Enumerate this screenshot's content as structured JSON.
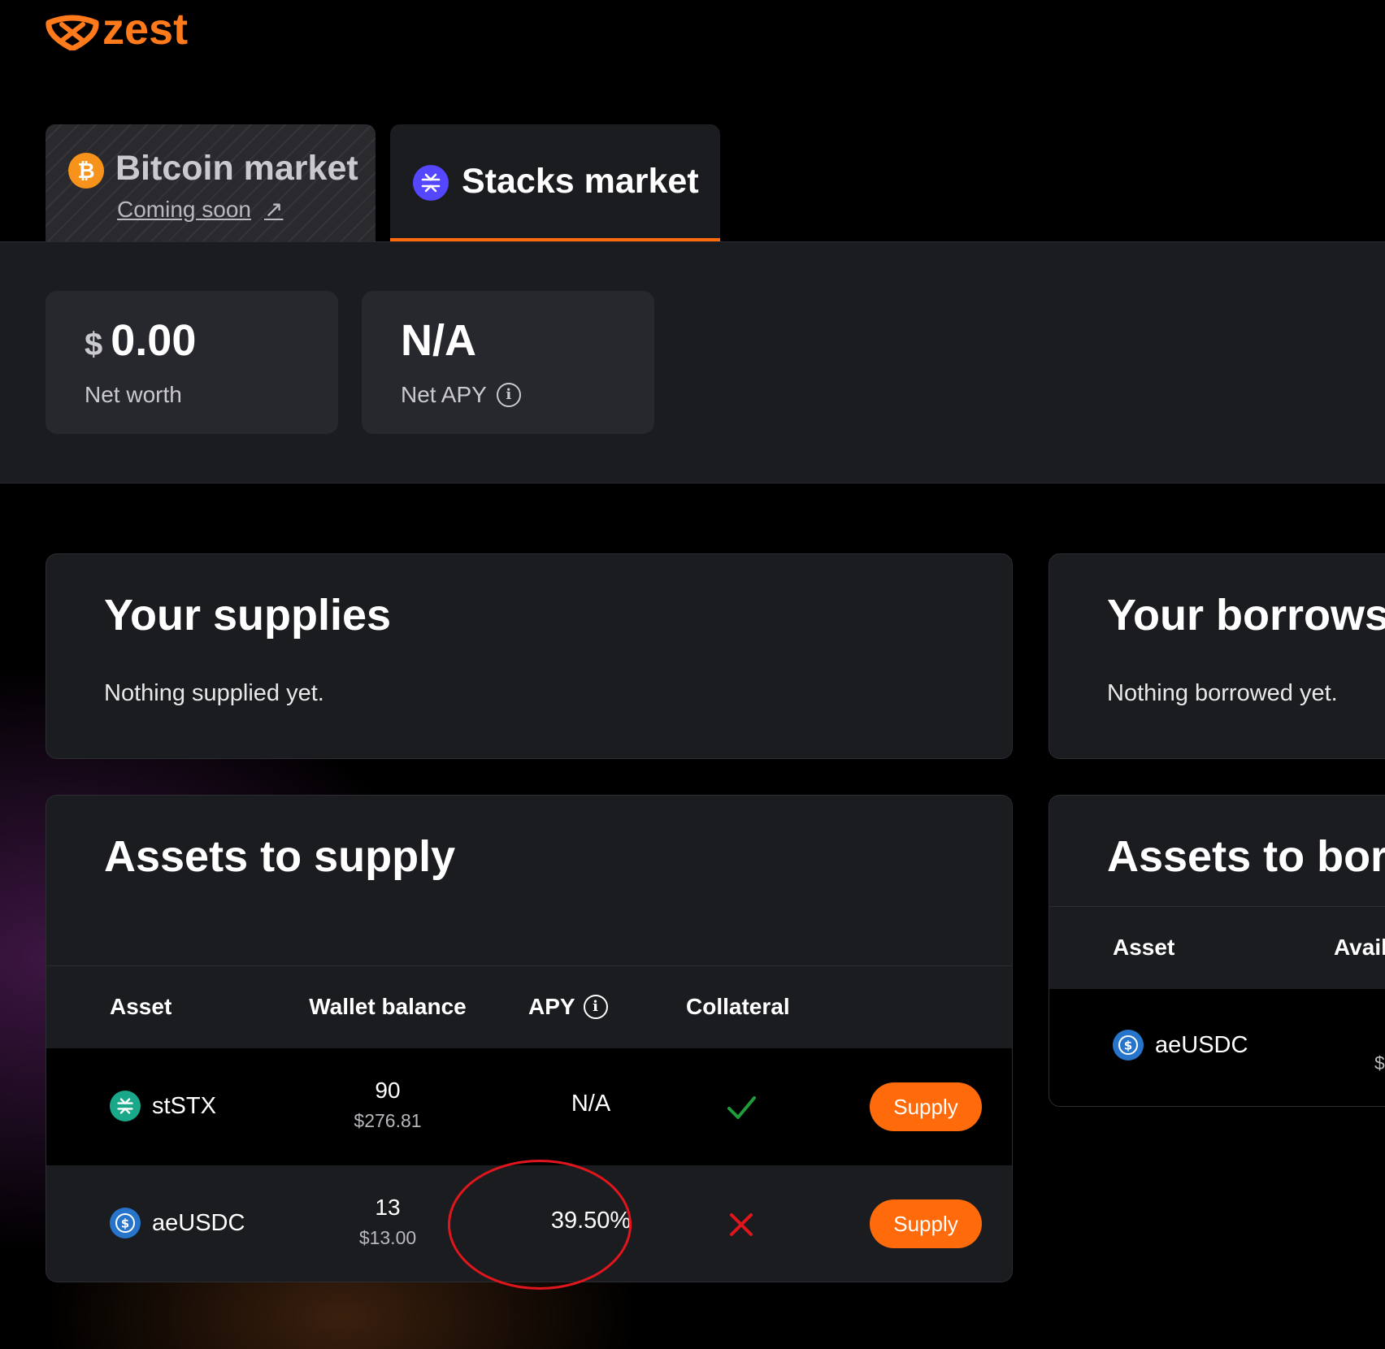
{
  "brand": {
    "name": "zest",
    "color": "#ff7a1a"
  },
  "tabs": [
    {
      "label": "Bitcoin market",
      "sub": "Coming soon",
      "icon": "bitcoin-icon",
      "active": false
    },
    {
      "label": "Stacks market",
      "icon": "stacks-icon",
      "active": true
    }
  ],
  "stats": {
    "net_worth": {
      "currency": "$",
      "value": "0.00",
      "label": "Net worth"
    },
    "net_apy": {
      "value": "N/A",
      "label": "Net APY"
    }
  },
  "supplies": {
    "title": "Your supplies",
    "empty": "Nothing supplied yet."
  },
  "borrows": {
    "title": "Your borrows",
    "empty": "Nothing borrowed yet."
  },
  "supply_assets": {
    "title": "Assets to supply",
    "headers": {
      "asset": "Asset",
      "wallet_balance": "Wallet balance",
      "apy": "APY",
      "collateral": "Collateral"
    },
    "rows": [
      {
        "asset": "stSTX",
        "icon": "ststx-icon",
        "balance": "90",
        "balance_usd": "$276.81",
        "apy": "N/A",
        "collateral": true,
        "action": "Supply"
      },
      {
        "asset": "aeUSDC",
        "icon": "usdc-icon",
        "balance": "13",
        "balance_usd": "$13.00",
        "apy": "39.50%",
        "collateral": false,
        "action": "Supply"
      }
    ]
  },
  "borrow_assets": {
    "title": "Assets to borrow",
    "headers": {
      "asset": "Asset",
      "available": "Available"
    },
    "rows": [
      {
        "asset": "aeUSDC",
        "icon": "usdc-icon",
        "available_usd": "$"
      }
    ]
  },
  "colors": {
    "accent": "#ff6a0a",
    "check": "#1f9d3a",
    "cross": "#e0161c"
  }
}
